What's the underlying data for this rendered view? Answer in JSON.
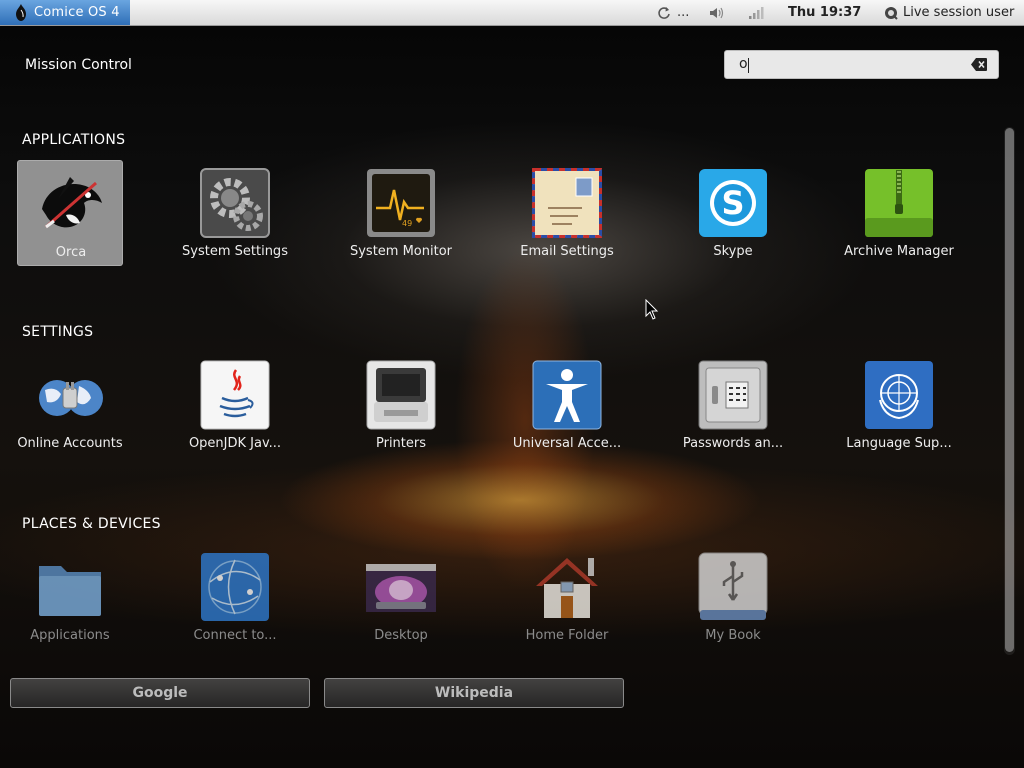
{
  "panel": {
    "activities_label": "Comice OS 4",
    "clock": "Thu 19:37",
    "session_label": "Live session user",
    "tray_ellipsis": "..."
  },
  "header": {
    "title": "Mission Control",
    "search_value": "o"
  },
  "sections": {
    "applications": "APPLICATIONS",
    "settings": "SETTINGS",
    "places": "PLACES & DEVICES"
  },
  "applications": [
    {
      "label": "Orca",
      "icon": "orca-icon"
    },
    {
      "label": "System Settings",
      "icon": "gear-icon"
    },
    {
      "label": "System Monitor",
      "icon": "monitor-icon"
    },
    {
      "label": "Email Settings",
      "icon": "envelope-icon"
    },
    {
      "label": "Skype",
      "icon": "skype-icon"
    },
    {
      "label": "Archive Manager",
      "icon": "archive-icon"
    }
  ],
  "settings": [
    {
      "label": "Online Accounts",
      "icon": "globe-icon"
    },
    {
      "label": "OpenJDK Jav...",
      "icon": "java-icon"
    },
    {
      "label": "Printers",
      "icon": "printer-icon"
    },
    {
      "label": "Universal Acce...",
      "icon": "accessibility-icon"
    },
    {
      "label": "Passwords an...",
      "icon": "safe-icon"
    },
    {
      "label": "Language Sup...",
      "icon": "un-flag-icon"
    }
  ],
  "places": [
    {
      "label": "Applications",
      "icon": "folder-icon"
    },
    {
      "label": "Connect to...",
      "icon": "network-icon"
    },
    {
      "label": "Desktop",
      "icon": "desktop-icon"
    },
    {
      "label": "Home Folder",
      "icon": "home-icon"
    },
    {
      "label": "My Book",
      "icon": "usb-drive-icon"
    }
  ],
  "providers": {
    "google": "Google",
    "wikipedia": "Wikipedia"
  },
  "colors": {
    "activities": "#2f6fb7",
    "panel": "#e6e6e6",
    "selected_tile": "#bebebe"
  }
}
